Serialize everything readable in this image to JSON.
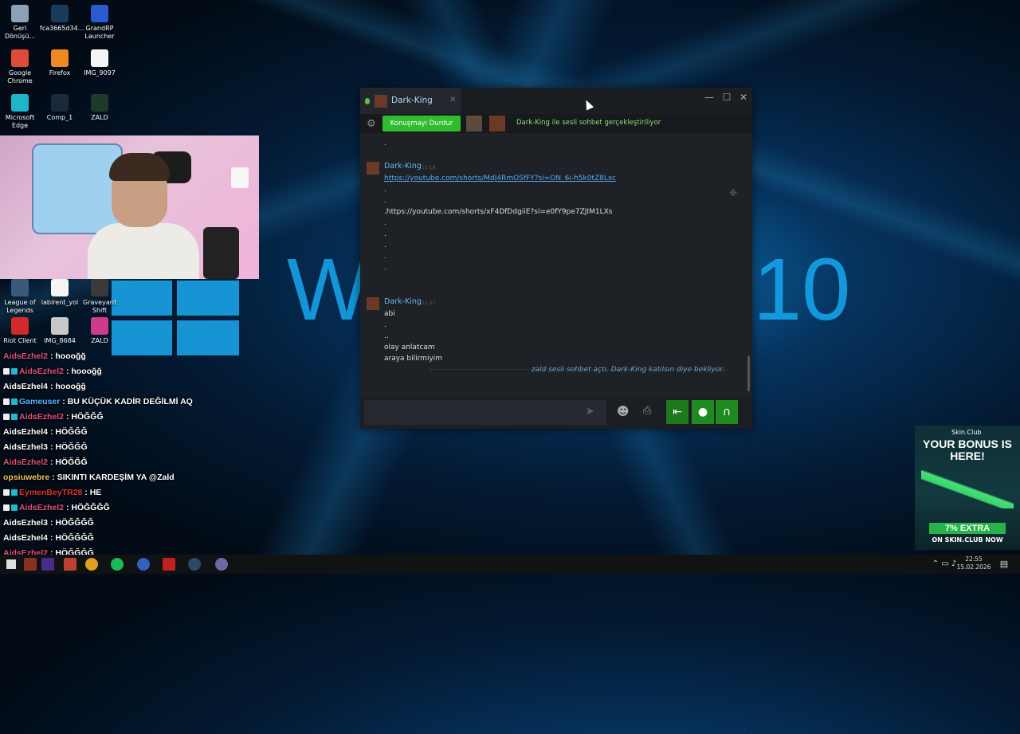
{
  "desktop": {
    "background_text": "Windows 10",
    "icons": [
      {
        "label": "Geri Dönüşü...",
        "color": "#8aa2b8"
      },
      {
        "label": "fca3665d34...",
        "color": "#1a3a5a"
      },
      {
        "label": "GrandRP Launcher",
        "color": "#2a5ad0"
      },
      {
        "label": "Google Chrome",
        "color": "#e04a3a"
      },
      {
        "label": "Firefox",
        "color": "#f08a20"
      },
      {
        "label": "IMG_9097",
        "color": "#f5f5f5"
      },
      {
        "label": "Microsoft Edge",
        "color": "#1fb5c8"
      },
      {
        "label": "Comp_1",
        "color": "#1a2a3a"
      },
      {
        "label": "ZALD",
        "color": "#1d3a2a"
      },
      {
        "label": "League of Legends",
        "color": "#3a5a7a"
      },
      {
        "label": "labirent_yol",
        "color": "#f5f5f5"
      },
      {
        "label": "Graveyard Shift",
        "color": "#3a3a3a"
      },
      {
        "label": "Riot Client",
        "color": "#d02a2a"
      },
      {
        "label": "IMG_8684",
        "color": "#c8c8c8"
      },
      {
        "label": "ZALD",
        "color": "#d03a8a"
      }
    ]
  },
  "stream_chat": [
    {
      "user": "AidsEzhel2",
      "text": ": hoooğğ",
      "color": "#e0507a",
      "badges": 0
    },
    {
      "user": "AidsEzhel2",
      "text": ": hoooğğ",
      "color": "#e0507a",
      "badges": 2
    },
    {
      "user": "AidsEzhel4",
      "text": ": hoooğğ",
      "color": "#ffffff",
      "badges": 0
    },
    {
      "user": "Gameuser",
      "text": ": BU KÜÇÜK KADİR DEĞİLMİ AQ",
      "color": "#5ab4ff",
      "badges": 2
    },
    {
      "user": "AidsEzhel2",
      "text": ": HÖĞĞĞ",
      "color": "#e0507a",
      "badges": 2
    },
    {
      "user": "AidsEzhel4",
      "text": ": HÖĞĞĞ",
      "color": "#ffffff",
      "badges": 0
    },
    {
      "user": "AidsEzhel3",
      "text": ": HÖĞĞĞ",
      "color": "#ffffff",
      "badges": 0
    },
    {
      "user": "AidsEzhel2",
      "text": ": HÖĞĞĞ",
      "color": "#e0507a",
      "badges": 0
    },
    {
      "user": "opsiuwebre",
      "text": ": SIKINTI KARDEŞİM YA @Zald",
      "color": "#f0c060",
      "badges": 0
    },
    {
      "user": "EymenBeyTR28",
      "text": ": HE",
      "color": "#e03030",
      "badges": 2
    },
    {
      "user": "AidsEzhel2",
      "text": ": HÖĞĞĞĞ",
      "color": "#e0507a",
      "badges": 2
    },
    {
      "user": "AidsEzhel3",
      "text": ": HÖĞĞĞĞ",
      "color": "#ffffff",
      "badges": 0
    },
    {
      "user": "AidsEzhel4",
      "text": ": HÖĞĞĞĞ",
      "color": "#ffffff",
      "badges": 0
    },
    {
      "user": "AidsEzhel2",
      "text": ": HÖĞĞĞĞ",
      "color": "#e0507a",
      "badges": 0
    }
  ],
  "steam_chat": {
    "tab_name": "Dark-King",
    "window_controls": {
      "minimize": "—",
      "maximize": "☐",
      "close": "✕"
    },
    "stop_button": "Konuşmayı Durdur",
    "voice_status": "Dark-King ile sesli sohbet gerçekleştiriliyor",
    "messages": [
      {
        "author": "Dark-King",
        "time": "15:18",
        "lines": [
          {
            "text": "https://youtube.com/shorts/MdJ4RmOSfFY?si=ON_6i-h5k0tZ8Lxc",
            "link": true
          },
          {
            "text": ".",
            "link": false
          },
          {
            "text": ".",
            "link": false
          },
          {
            "text": ".https://youtube.com/shorts/xF4DfDdgiiE?si=e0fY9pe7ZJIM1LXs",
            "link": false
          },
          {
            "text": ".",
            "link": false
          },
          {
            "text": ".",
            "link": false
          },
          {
            "text": ".",
            "link": false
          },
          {
            "text": ".",
            "link": false
          },
          {
            "text": ".",
            "link": false
          }
        ]
      },
      {
        "author": "Dark-King",
        "time": "22:52",
        "lines": [
          {
            "text": "abi",
            "link": false
          },
          {
            "text": ".",
            "link": false
          },
          {
            "text": "..",
            "link": false
          },
          {
            "text": "olay anlatcam",
            "link": false
          },
          {
            "text": "araya bilirmiyim",
            "link": false
          }
        ]
      }
    ],
    "top_dot": ".",
    "system_message": "zald sesli sohbet açtı. Dark-King katılsın diye bekliyor."
  },
  "ad": {
    "brand": "Skin.Club",
    "headline": "YOUR BONUS IS HERE!",
    "offer": "7% EXTRA",
    "sub": "ON SKIN.CLUB NOW"
  },
  "taskbar": {
    "time": "22:55",
    "date": "15.02.2026"
  }
}
